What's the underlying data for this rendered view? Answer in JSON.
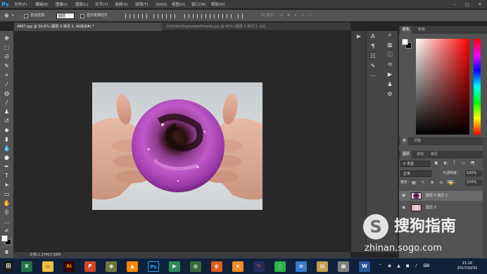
{
  "app": {
    "logo": "Ps"
  },
  "menu": [
    "文件(F)",
    "编辑(E)",
    "图像(I)",
    "图层(L)",
    "文字(Y)",
    "选择(S)",
    "滤镜(T)",
    "3D(D)",
    "视图(V)",
    "窗口(W)",
    "帮助(H)"
  ],
  "options": {
    "auto_select_label": "自动选择：",
    "auto_select_value": "图层",
    "show_transform_label": "显示变换控件",
    "mode_3d": "3D 模式："
  },
  "tabs": [
    {
      "label": "4867.jpg @ 59.6% (图层 0 拷贝 2, RGB/8#) *"
    },
    {
      "label": "16354b33eghewjb4hhw4g.jpg @ 40% (图层 0 拷贝 2, RGB/8#) *"
    }
  ],
  "status": {
    "doc_size": "文档:1.37M/2.58M"
  },
  "color_panel": {
    "tab1": "颜色",
    "tab2": "色板",
    "fg": "#ffffff",
    "bg": "#000000"
  },
  "lib_panel": {
    "tab1": "库",
    "tab2": "调整"
  },
  "layers_panel": {
    "tabs": [
      "图层",
      "通道",
      "路径"
    ],
    "kind": "类型",
    "blend": "正常",
    "opacity_label": "不透明度：",
    "opacity": "100%",
    "lock_label": "锁定：",
    "fill_label": "填充：",
    "fill": "100%",
    "layers": [
      {
        "name": "图层 0 拷贝 2",
        "active": true
      },
      {
        "name": "图层 0",
        "active": false
      }
    ]
  },
  "watermark": {
    "brand": "搜狗指南",
    "url": "zhinan.sogo.com"
  },
  "clock": {
    "time": "21:16",
    "date": "2017/10/31"
  },
  "taskbar_apps": [
    "excel",
    "explorer",
    "illustrator",
    "powerpoint",
    "game",
    "vlc",
    "photoshop",
    "media",
    "firefox",
    "store",
    "paint",
    "app",
    "browser",
    "wifi",
    "files",
    "file2",
    "word"
  ]
}
